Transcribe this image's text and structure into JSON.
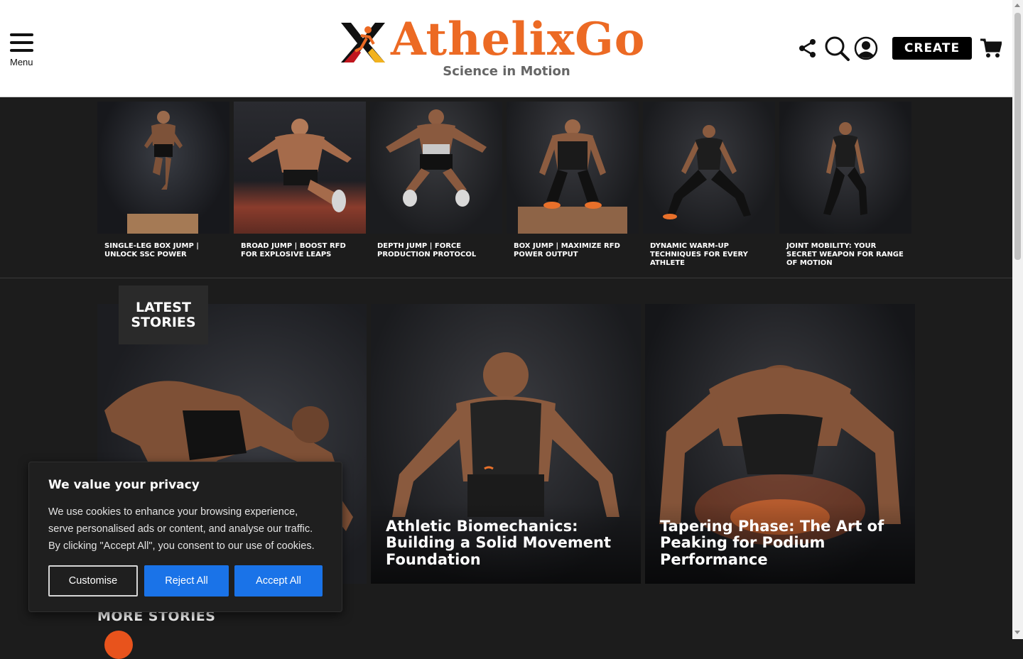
{
  "header": {
    "menu_label": "Menu",
    "logo_text": "AthelixGo",
    "tagline": "Science in Motion",
    "create_label": "CREATE",
    "icons": [
      "share-icon",
      "search-icon",
      "user-account-icon",
      "cart-icon"
    ]
  },
  "featured": [
    {
      "title": "SINGLE-LEG BOX JUMP | UNLOCK SSC POWER"
    },
    {
      "title": "BROAD JUMP | BOOST RFD FOR EXPLOSIVE LEAPS"
    },
    {
      "title": "DEPTH JUMP | FORCE PRODUCTION PROTOCOL"
    },
    {
      "title": "BOX JUMP | MAXIMIZE RFD POWER OUTPUT"
    },
    {
      "title": "DYNAMIC WARM-UP TECHNIQUES FOR EVERY ATHLETE"
    },
    {
      "title": "JOINT MOBILITY: YOUR SECRET WEAPON FOR RANGE OF MOTION"
    }
  ],
  "latest": {
    "heading": "LATEST STORIES",
    "stories": [
      {
        "title": ""
      },
      {
        "title": "Athletic Biomechanics: Building a Solid Movement Foundation"
      },
      {
        "title": "Tapering Phase: The Art of Peaking for Podium Performance"
      }
    ]
  },
  "more_stories": {
    "heading": "MORE STORIES"
  },
  "cookie": {
    "title": "We value your privacy",
    "body": "We use cookies to enhance your browsing experience, serve personalised ads or content, and analyse our traffic. By clicking \"Accept All\", you consent to our use of cookies.",
    "customise_label": "Customise",
    "reject_label": "Reject All",
    "accept_label": "Accept All"
  },
  "colors": {
    "brand_orange": "#ec6a24",
    "dark_bg": "#1c1c1c",
    "button_blue": "#1a73e8"
  }
}
